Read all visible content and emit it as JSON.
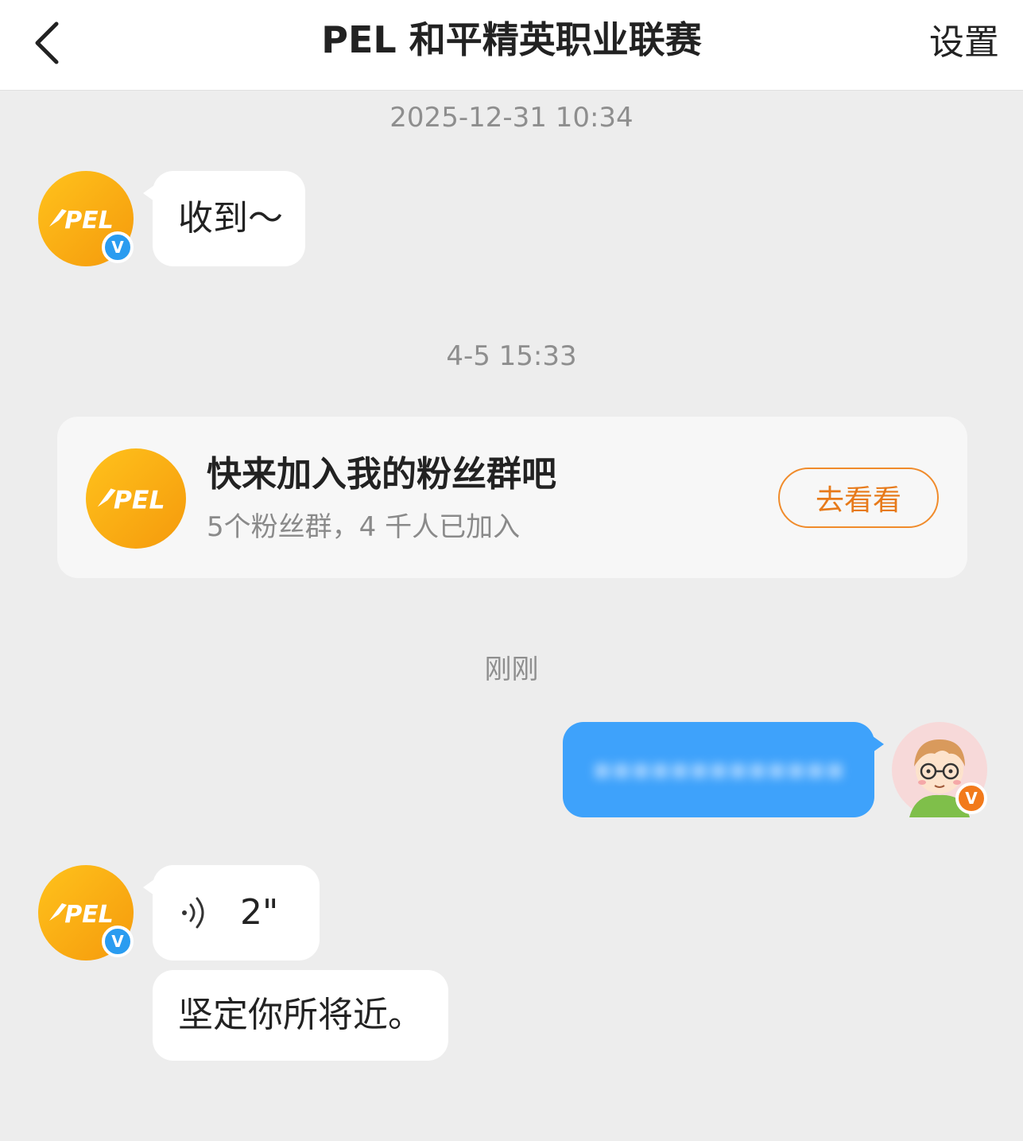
{
  "header": {
    "title": "PEL 和平精英职业联赛",
    "settings_label": "设置"
  },
  "timestamps": {
    "t1": "2025-12-31 10:34",
    "t2": "4-5 15:33",
    "t3": "刚刚"
  },
  "avatars": {
    "pel_logo_text": "PEL",
    "badge_text": "V"
  },
  "messages": {
    "msg1": "收到～",
    "fan_card": {
      "title": "快来加入我的粉丝群吧",
      "subtitle": "5个粉丝群，4 千人已加入",
      "button_label": "去看看"
    },
    "my_message_hidden": "▪▪▪▪▪▪▪▪▪▪▪▪▪",
    "voice_duration": "2\"",
    "msg_last": "坚定你所将近。"
  },
  "colors": {
    "accent_orange": "#f08b2b",
    "my_bubble": "#3ea2fb",
    "verified_blue": "#2a9cf0",
    "verified_orange": "#f27a1b"
  }
}
